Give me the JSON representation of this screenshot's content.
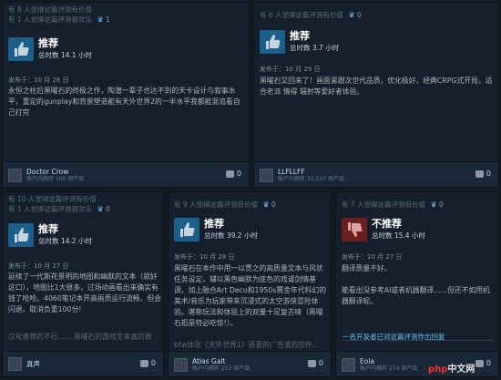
{
  "reviews": [
    {
      "helpful": "有 8 人觉得这篇评测有价值",
      "funny": "有 1 人觉得这篇评测很欢乐",
      "awards": "1",
      "verdict": "推荐",
      "hours": "总时数 14.1 小时",
      "posted": "发布于：10 月 28 日",
      "body": "永恒之柱后黑曜石的终极之作，陶潜一辈子也达不到的天卡设计与叙事水平，重定的gunplay和背景塑造能有天外世界2的一半水平我都能混追看自己打完",
      "author": "Doctor Crow",
      "author_meta": "帐户内拥有 165 项产品",
      "comments": "0"
    },
    {
      "helpful": "有 6 人觉得这篇评测有价值",
      "funny": "",
      "awards": "0",
      "verdict": "推荐",
      "hours": "总时数 3.7 小时",
      "posted": "发布于：10 月 29 日",
      "body": "黑曜石又回来了！画面紧跟次世代品质，优化极好，经典CRPG式开局，适合老派 情得 辐射等爱好者体验。",
      "author": "LLFLLFF",
      "author_meta": "帐户内拥有 32,510 项产品",
      "comments": "0"
    },
    {
      "helpful": "有 10 人觉得这篇评测有价值",
      "funny": "有 1 人觉得这篇评测很欢乐",
      "awards": "0",
      "verdict": "推荐",
      "hours": "总时数 14.2 小时",
      "posted": "发布于：10 月 27 日",
      "body": "延续了一代斯花景明的地图和幽默的文本（就好这口），地图比1大很多，过场动画看出来确实有钱了哈哈。4060笔记本开高画质运行流畅，但会闪退。取消负重100分!",
      "body_faded": "汉化推荐的不行.......黑曜石的游戏文本真的奇",
      "author": "真声",
      "author_meta": "",
      "comments": "0"
    },
    {
      "helpful": "有 9 人觉得这篇评测有价值",
      "funny": "",
      "awards": "0",
      "verdict": "推荐",
      "hours": "总时数 39.2 小时",
      "posted": "发布于：10 月 28 日",
      "body": "黑曜石在本作中用一以贯之的高质量文本与风状任务设定，辅以黑色幽默为底色的戏谑剑情基调，加上融合Art Deco和1950s赛金年代科幻的美术/音乐为玩家带来沉浸式的太空游侠冒险体验。堪称玩法和体验上的双量十足复古味（黑曜石祖是特必吃惊!）。",
      "body_faded": "btw体现《天外世界1》恶意的广告谁的宗件...",
      "author": "Atlas Galt",
      "author_meta": "帐户内拥有 253 项产品",
      "comments": "0"
    },
    {
      "helpful": "有 7 人觉得这篇评测有价值",
      "funny": "",
      "awards": "0",
      "verdict": "不推荐",
      "hours": "总时数 15.4 小时",
      "posted": "发布于：10 月 27 日",
      "body": "翻译质量不好。\n\n能看出没参考AI或者机器翻译......但还不如用机器翻译呢。",
      "author": "Eola",
      "author_meta": "帐户内拥有 274 项产品",
      "comments": "0"
    }
  ],
  "dev_response": "一名开发者已对这篇评测作出回复",
  "brand": {
    "left": "php",
    "right": "中文网"
  },
  "colors": {
    "positive": "#1b5f8a",
    "negative": "#6b1f1f",
    "link": "#67c1f5"
  }
}
